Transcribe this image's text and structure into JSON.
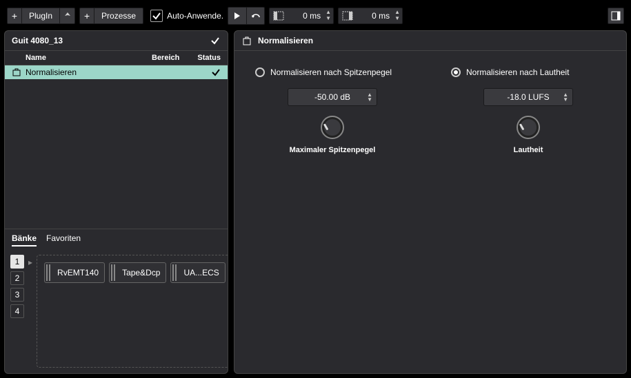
{
  "toolbar": {
    "plugin_label": "PlugIn",
    "processes_label": "Prozesse",
    "auto_apply_label": "Auto-Anwende.",
    "auto_apply_checked": true,
    "pre_roll_value": "0 ms",
    "post_roll_value": "0 ms"
  },
  "left": {
    "title": "Guit 4080_13",
    "columns": {
      "name": "Name",
      "range": "Bereich",
      "status": "Status"
    },
    "rows": [
      {
        "name": "Normalisieren",
        "range": "",
        "status": "checked"
      }
    ],
    "tabs": {
      "banks": "Bänke",
      "favorites": "Favoriten"
    },
    "bank_numbers": [
      "1",
      "2",
      "3",
      "4"
    ],
    "active_bank": "1",
    "favorites": [
      "RvEMT140",
      "Tape&Dcp",
      "UA...ECS"
    ]
  },
  "right": {
    "title": "Normalisieren",
    "option_peak": "Normalisieren nach Spitzenpegel",
    "option_loudness": "Normalisieren nach Lautheit",
    "selected": "loudness",
    "peak_value": "-50.00 dB",
    "loudness_value": "-18.0 LUFS",
    "peak_knob_label": "Maximaler Spitzenpegel",
    "loudness_knob_label": "Lautheit"
  },
  "colors": {
    "selected_row": "#9cd6c8"
  }
}
